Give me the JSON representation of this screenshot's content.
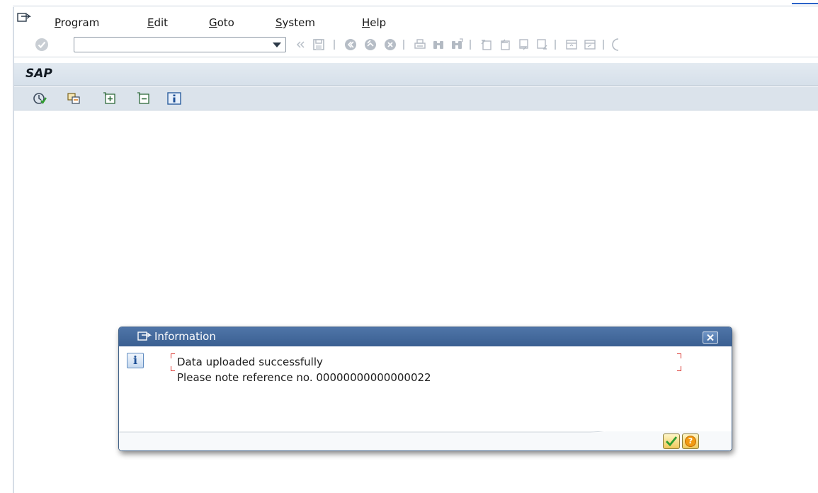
{
  "menubar": {
    "items": [
      {
        "underline": "P",
        "rest": "rogram"
      },
      {
        "underline": "E",
        "rest": "dit"
      },
      {
        "underline": "G",
        "rest": "oto"
      },
      {
        "underline": "S",
        "rest": "ystem"
      },
      {
        "underline": "H",
        "rest": "elp"
      }
    ]
  },
  "toolbar": {
    "command_field_value": "",
    "icons": [
      "enter-icon",
      "back-double-chevron-icon",
      "save-icon",
      "back-icon",
      "exit-icon",
      "cancel-icon",
      "print-icon",
      "find-icon",
      "find-next-icon",
      "first-page-icon",
      "previous-page-icon",
      "next-page-icon",
      "last-page-icon",
      "create-session-icon",
      "shortcut-icon",
      "help-icon"
    ]
  },
  "titlebar": {
    "title": "SAP"
  },
  "apptoolbar": {
    "icons": [
      "execute-icon",
      "copy-icon",
      "expand-icon",
      "collapse-icon",
      "info-icon"
    ]
  },
  "dialog": {
    "title": "Information",
    "line1": "Data uploaded successfully",
    "line2": "Please note reference no. 00000000000000022",
    "help_glyph": "?",
    "info_glyph": "i"
  },
  "colors": {
    "title_bar": "#d6e0ea",
    "dialog_header": "#3a5f91",
    "bracket_red": "#d9312b",
    "ok_green": "#2f9e2f",
    "help_orange": "#f29a12"
  }
}
